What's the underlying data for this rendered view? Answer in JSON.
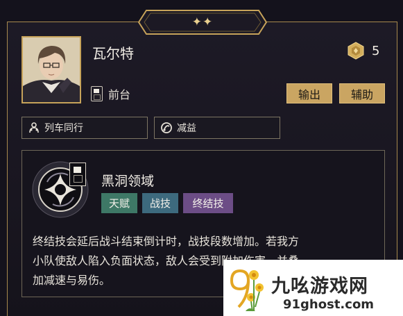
{
  "header": {
    "stars": "✦✦"
  },
  "character": {
    "name": "瓦尔特",
    "cost": "5",
    "position_label": "前台",
    "roles": [
      "输出",
      "辅助"
    ]
  },
  "tags": [
    {
      "label": "列车同行",
      "icon": "party-icon"
    },
    {
      "label": "减益",
      "icon": "debuff-icon"
    }
  ],
  "skill": {
    "name": "黑洞领域",
    "chips": [
      "天赋",
      "战技",
      "终结技"
    ],
    "description_lines": [
      "终结技会延后战斗结束倒计时，战技段数增加。若我方",
      "小队使敌人陷入负面状态，敌人会受到附加伤害，并叠",
      "加减速与易伤。"
    ]
  },
  "watermark": {
    "title": "九吆游戏网",
    "url": "91ghost.com"
  },
  "colors": {
    "gold": "#caa562",
    "frame_border": "#a88a4e",
    "chip_talent": "#3e7866",
    "chip_skill": "#3d6a7e",
    "chip_ultimate": "#6c4d86"
  }
}
